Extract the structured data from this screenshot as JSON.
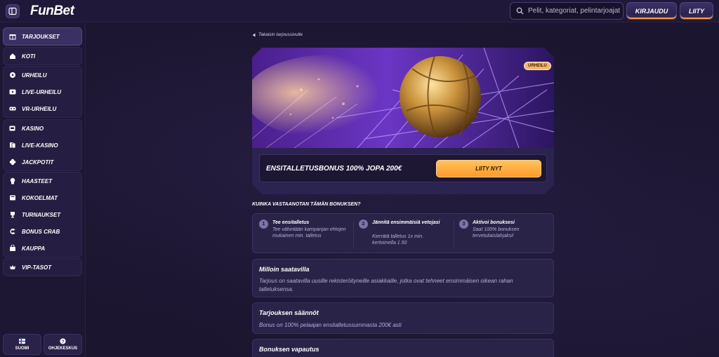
{
  "brand": {
    "logo": "FunBet",
    "accent": "#ff9a2c"
  },
  "header": {
    "search_placeholder": "Pelit, kategoriat, pelintarjoajat",
    "login_label": "KIRJAUDU",
    "join_label": "LIITY"
  },
  "sidebar": {
    "groups": [
      {
        "items": [
          {
            "label": "TARJOUKSET",
            "icon": "gift-icon"
          }
        ]
      },
      {
        "items": [
          {
            "label": "KOTI",
            "icon": "home-icon"
          }
        ]
      },
      {
        "items": [
          {
            "label": "URHEILU",
            "icon": "soccer-ball-icon"
          },
          {
            "label": "LIVE-URHEILU",
            "icon": "play-icon"
          },
          {
            "label": "VR-URHEILU",
            "icon": "vr-headset-icon"
          }
        ]
      },
      {
        "items": [
          {
            "label": "KASINO",
            "icon": "slot-icon"
          },
          {
            "label": "LIVE-KASINO",
            "icon": "cards-icon"
          },
          {
            "label": "JACKPOTIT",
            "icon": "clover-icon"
          }
        ]
      },
      {
        "items": [
          {
            "label": "HAASTEET",
            "icon": "medal-icon"
          },
          {
            "label": "KOKOELMAT",
            "icon": "album-icon"
          },
          {
            "label": "TURNAUKSET",
            "icon": "trophy-icon"
          },
          {
            "label": "BONUS CRAB",
            "icon": "crab-claw-icon"
          },
          {
            "label": "KAUPPA",
            "icon": "shop-icon"
          }
        ]
      },
      {
        "items": [
          {
            "label": "VIP-TASOT",
            "icon": "crown-icon"
          }
        ]
      }
    ],
    "language_label": "SUOMI",
    "help_label": "OHJEKESKUS"
  },
  "main": {
    "back_label": "Takaisin tarjoussivulle",
    "badge": "URHEILU",
    "offer_title": "ENSITALLETUSBONUS 100% JOPA 200€",
    "cta_label": "LIITY NYT",
    "how_title": "KUINKA VASTAANOTAN TÄMÄN BONUKSEN?",
    "steps": [
      {
        "num": "1",
        "title": "Tee ensitalletus",
        "body": "Tee vähintään kampanjan ehtojen mukainen min. talletus"
      },
      {
        "num": "2",
        "title": "Jännitä ensimmäisiä vetojasi",
        "body": "Kierrätä talletus 1x min. kertoimella 1.50"
      },
      {
        "num": "3",
        "title": "Aktivoi bonuksesi",
        "body": "Saat 100% bonuksen tervetuliaislahjaksi!"
      }
    ],
    "availability": {
      "title": "Milloin saatavilla",
      "body": "Tarjous on saatavilla uusille rekisteröityneille asiakkaille, jotka ovat tehneet ensimmäisen oikean rahan talletuksensa."
    },
    "rules": {
      "title": "Tarjouksen säännöt",
      "body": "Bonus on 100% pelaajan ensitalletussummasta 200€ asti"
    },
    "release": {
      "title": "Bonuksen vapautus"
    }
  }
}
